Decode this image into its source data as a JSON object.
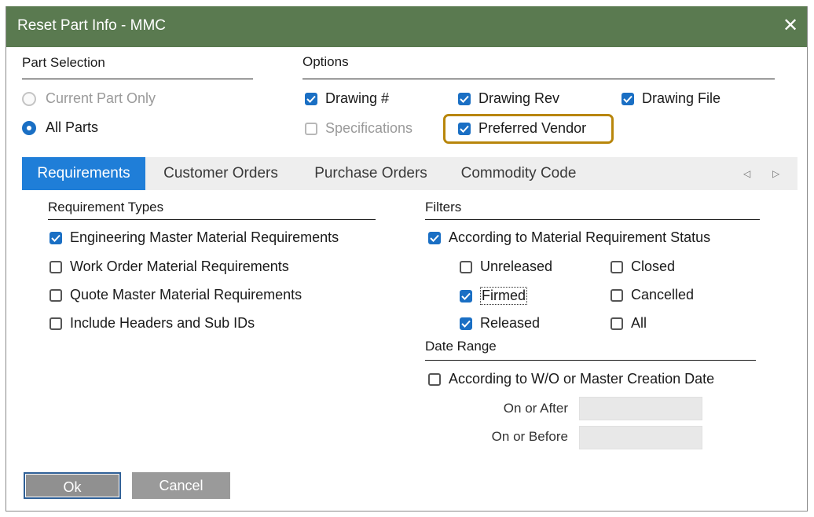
{
  "window": {
    "title": "Reset Part Info - MMC"
  },
  "part_selection": {
    "title": "Part Selection",
    "options": [
      {
        "label": "Current Part Only",
        "selected": false,
        "disabled": true
      },
      {
        "label": "All Parts",
        "selected": true,
        "disabled": false
      }
    ]
  },
  "options": {
    "title": "Options",
    "drawing_num": {
      "label": "Drawing #",
      "checked": true
    },
    "drawing_rev": {
      "label": "Drawing Rev",
      "checked": true
    },
    "drawing_file": {
      "label": "Drawing File",
      "checked": true
    },
    "specifications": {
      "label": "Specifications",
      "checked": false,
      "disabled": true
    },
    "preferred_vendor": {
      "label": "Preferred Vendor",
      "checked": true,
      "highlighted": true
    }
  },
  "tabs": [
    {
      "label": "Requirements",
      "active": true
    },
    {
      "label": "Customer Orders",
      "active": false
    },
    {
      "label": "Purchase Orders",
      "active": false
    },
    {
      "label": "Commodity Code",
      "active": false
    }
  ],
  "tab_scroll": {
    "left_icon": "◁",
    "right_icon": "▷"
  },
  "requirement_types": {
    "title": "Requirement Types",
    "items": [
      {
        "label": "Engineering Master Material Requirements",
        "checked": true
      },
      {
        "label": "Work Order Material Requirements",
        "checked": false
      },
      {
        "label": "Quote Master Material Requirements",
        "checked": false
      },
      {
        "label": "Include Headers and Sub IDs",
        "checked": false
      }
    ]
  },
  "filters": {
    "title": "Filters",
    "by_status": {
      "label": "According to Material Requirement Status",
      "checked": true
    },
    "statuses": {
      "unreleased": {
        "label": "Unreleased",
        "checked": false
      },
      "firmed": {
        "label": "Firmed",
        "checked": true
      },
      "released": {
        "label": "Released",
        "checked": true
      },
      "closed": {
        "label": "Closed",
        "checked": false
      },
      "cancelled": {
        "label": "Cancelled",
        "checked": false
      },
      "all": {
        "label": "All",
        "checked": false
      }
    }
  },
  "date_range": {
    "title": "Date Range",
    "by_date": {
      "label": "According to W/O or Master Creation Date",
      "checked": false
    },
    "on_or_after": {
      "label": "On or After",
      "value": ""
    },
    "on_or_before": {
      "label": "On or Before",
      "value": ""
    }
  },
  "buttons": {
    "ok": "Ok",
    "cancel": "Cancel"
  },
  "colors": {
    "titlebar": "#5a7a50",
    "active_tab": "#1f7ed8",
    "checkbox": "#1a6fc4",
    "highlight": "#b8860b"
  },
  "icons": {
    "close": "close-icon",
    "check": "check-icon"
  }
}
